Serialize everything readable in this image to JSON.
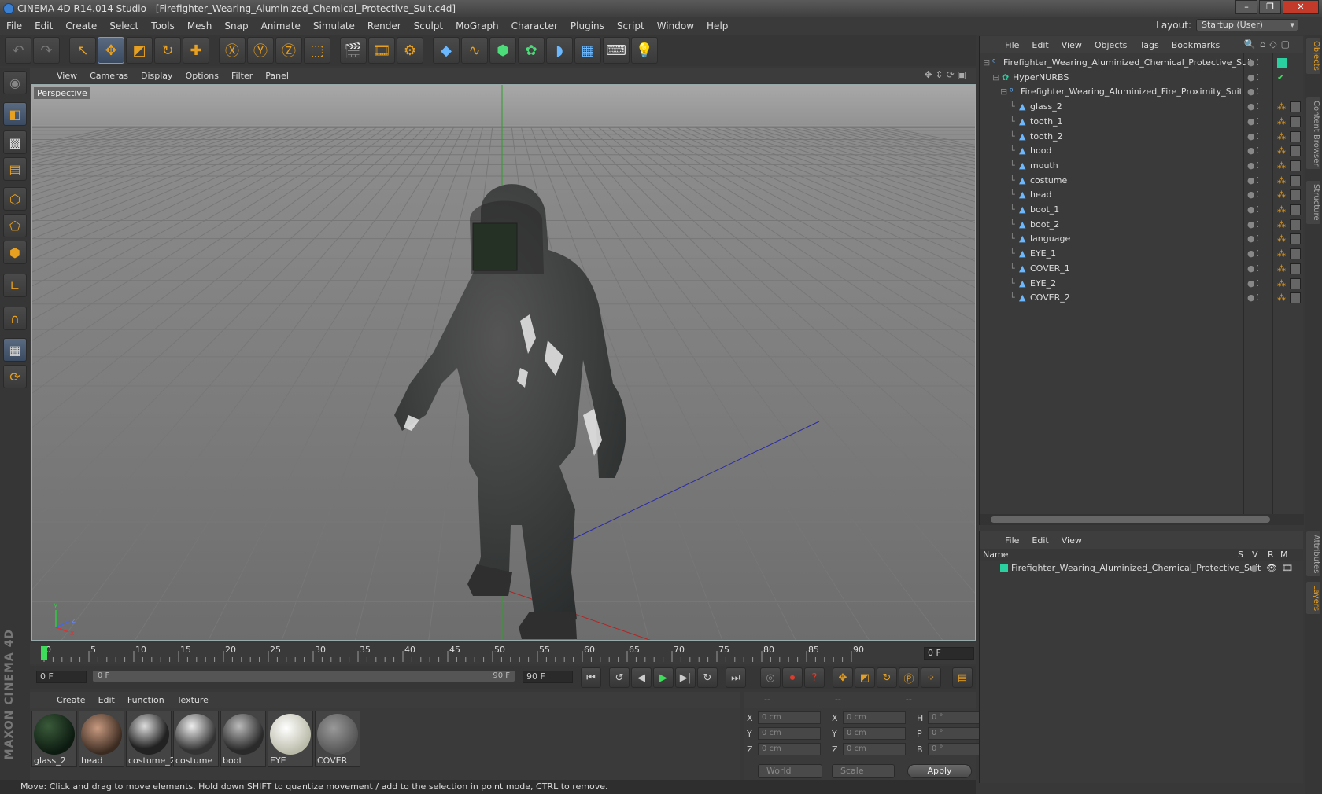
{
  "window": {
    "title": "CINEMA 4D R14.014 Studio - [Firefighter_Wearing_Aluminized_Chemical_Protective_Suit.c4d]"
  },
  "menu": [
    "File",
    "Edit",
    "Create",
    "Select",
    "Tools",
    "Mesh",
    "Snap",
    "Animate",
    "Simulate",
    "Render",
    "Sculpt",
    "MoGraph",
    "Character",
    "Plugins",
    "Script",
    "Window",
    "Help"
  ],
  "layout": {
    "label": "Layout:",
    "value": "Startup (User)"
  },
  "viewport": {
    "menu": [
      "View",
      "Cameras",
      "Display",
      "Options",
      "Filter",
      "Panel"
    ],
    "label": "Perspective"
  },
  "timeline": {
    "ticks": [
      "0",
      "5",
      "10",
      "15",
      "20",
      "25",
      "30",
      "35",
      "40",
      "45",
      "50",
      "55",
      "60",
      "65",
      "70",
      "75",
      "80",
      "85",
      "90"
    ],
    "current_frame": "0 F",
    "start": "0 F",
    "slider_start": "0 F",
    "slider_end": "90 F",
    "end": "90 F"
  },
  "materials": {
    "menu": [
      "Create",
      "Edit",
      "Function",
      "Texture"
    ],
    "items": [
      "glass_2",
      "head",
      "costume_2",
      "costume",
      "boot",
      "EYE",
      "COVER"
    ]
  },
  "coords": {
    "headers": [
      "--",
      "--",
      "--"
    ],
    "rows": [
      {
        "a": "X",
        "v1": "0 cm",
        "b": "X",
        "v2": "0 cm",
        "c": "H",
        "v3": "0 °"
      },
      {
        "a": "Y",
        "v1": "0 cm",
        "b": "Y",
        "v2": "0 cm",
        "c": "P",
        "v3": "0 °"
      },
      {
        "a": "Z",
        "v1": "0 cm",
        "b": "Z",
        "v2": "0 cm",
        "c": "B",
        "v3": "0 °"
      }
    ],
    "world": "World",
    "scale": "Scale",
    "apply": "Apply"
  },
  "status": "Move: Click and drag to move elements. Hold down SHIFT to quantize movement / add to the selection in point mode, CTRL to remove.",
  "objects": {
    "menu": [
      "File",
      "Edit",
      "View",
      "Objects",
      "Tags",
      "Bookmarks"
    ],
    "tree": [
      {
        "name": "Firefighter_Wearing_Aluminized_Chemical_Protective_Suit",
        "level": 0
      },
      {
        "name": "HyperNURBS",
        "level": 1
      },
      {
        "name": "Firefighter_Wearing_Aluminized_Fire_Proximity_Suit",
        "level": 2
      },
      {
        "name": "glass_2",
        "level": 3
      },
      {
        "name": "tooth_1",
        "level": 3
      },
      {
        "name": "tooth_2",
        "level": 3
      },
      {
        "name": "hood",
        "level": 3
      },
      {
        "name": "mouth",
        "level": 3
      },
      {
        "name": "costume",
        "level": 3
      },
      {
        "name": "head",
        "level": 3
      },
      {
        "name": "boot_1",
        "level": 3
      },
      {
        "name": "boot_2",
        "level": 3
      },
      {
        "name": "language",
        "level": 3
      },
      {
        "name": "EYE_1",
        "level": 3
      },
      {
        "name": "COVER_1",
        "level": 3
      },
      {
        "name": "EYE_2",
        "level": 3
      },
      {
        "name": "COVER_2",
        "level": 3
      }
    ]
  },
  "layers": {
    "menu": [
      "File",
      "Edit",
      "View"
    ],
    "columns": [
      "Name",
      "S",
      "V",
      "R",
      "M"
    ],
    "row": "Firefighter_Wearing_Aluminized_Chemical_Protective_Suit"
  },
  "right_tabs": [
    "Objects",
    "Content Browser",
    "Structure",
    "Attributes",
    "Layers"
  ],
  "maxon": "MAXON CINEMA 4D"
}
